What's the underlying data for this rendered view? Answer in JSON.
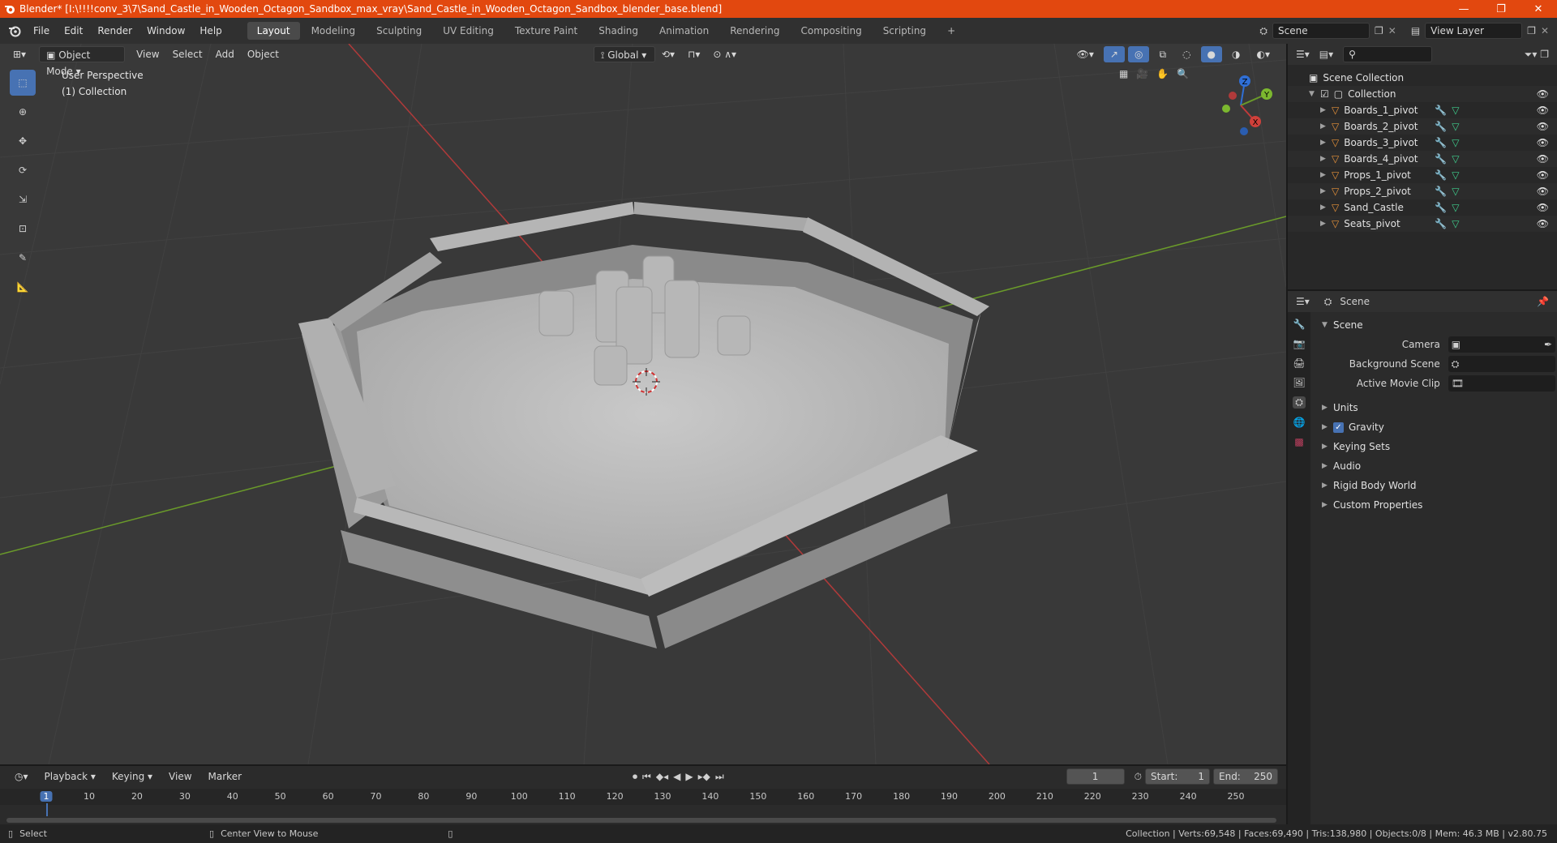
{
  "window": {
    "title": "Blender* [I:\\!!!!conv_3\\7\\Sand_Castle_in_Wooden_Octagon_Sandbox_max_vray\\Sand_Castle_in_Wooden_Octagon_Sandbox_blender_base.blend]",
    "minimize": "—",
    "maximize": "❐",
    "close": "✕"
  },
  "menu": [
    "File",
    "Edit",
    "Render",
    "Window",
    "Help"
  ],
  "workspaces": {
    "active": "Layout",
    "tabs": [
      "Layout",
      "Modeling",
      "Sculpting",
      "UV Editing",
      "Texture Paint",
      "Shading",
      "Animation",
      "Rendering",
      "Compositing",
      "Scripting"
    ],
    "add": "+"
  },
  "scene_field": "Scene",
  "view_layer_field": "View Layer",
  "viewport": {
    "mode": "Object Mode",
    "menus": [
      "View",
      "Select",
      "Add",
      "Object"
    ],
    "transform": "Global",
    "perspective": "User Perspective",
    "collection": "(1) Collection",
    "gizmo": {
      "z": "Z",
      "y": "Y",
      "x": "X"
    }
  },
  "outliner": {
    "root": "Scene Collection",
    "collection": "Collection",
    "items": [
      "Boards_1_pivot",
      "Boards_2_pivot",
      "Boards_3_pivot",
      "Boards_4_pivot",
      "Props_1_pivot",
      "Props_2_pivot",
      "Sand_Castle",
      "Seats_pivot"
    ]
  },
  "properties": {
    "header": "Scene",
    "section": "Scene",
    "fields": [
      {
        "label": "Camera"
      },
      {
        "label": "Background Scene"
      },
      {
        "label": "Active Movie Clip"
      }
    ],
    "panels": [
      "Units",
      "Gravity",
      "Keying Sets",
      "Audio",
      "Rigid Body World",
      "Custom Properties"
    ]
  },
  "timeline": {
    "menus": [
      "Playback",
      "Keying",
      "View",
      "Marker"
    ],
    "current_frame": "1",
    "start_label": "Start:",
    "start": "1",
    "end_label": "End:",
    "end": "250",
    "ticks": [
      "1",
      "10",
      "20",
      "30",
      "40",
      "50",
      "60",
      "70",
      "80",
      "90",
      "100",
      "110",
      "120",
      "130",
      "140",
      "150",
      "160",
      "170",
      "180",
      "190",
      "200",
      "210",
      "220",
      "230",
      "240",
      "250"
    ]
  },
  "status": {
    "select": "Select",
    "center_view": "Center View to Mouse",
    "stats": "Collection | Verts:69,548 | Faces:69,490 | Tris:138,980 | Objects:0/8 | Mem: 46.3 MB | v2.80.75"
  },
  "colors": {
    "titlebar": "#e2480f",
    "accent": "#4772b3",
    "object_orange": "#e8933a",
    "mesh_green": "#3fcf8e",
    "axis_red": "#b03a3a",
    "axis_green": "#6a9a2a"
  }
}
